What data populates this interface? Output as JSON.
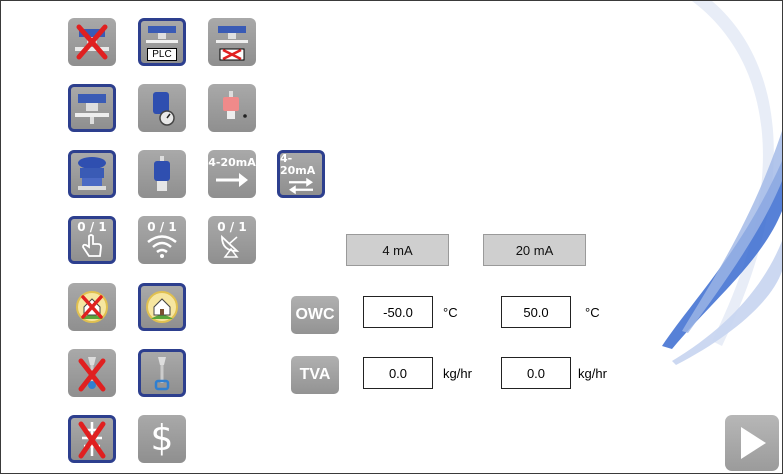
{
  "tiles": {
    "row4": [
      "0 / 1",
      "0 / 1",
      "0 / 1"
    ],
    "row3": {
      "current_out": "4-20mA",
      "current_bidir": "4-20mA"
    },
    "plc_label": "PLC",
    "currency": "$"
  },
  "calibration": {
    "btn_4ma": "4 mA",
    "btn_20ma": "20 mA"
  },
  "owc": {
    "label": "OWC",
    "low_value": "-50.0",
    "low_unit": "°C",
    "high_value": "50.0",
    "high_unit": "°C"
  },
  "tva": {
    "label": "TVA",
    "low_value": "0.0",
    "low_unit": "kg/hr",
    "high_value": "0.0",
    "high_unit": "kg/hr"
  },
  "icons": {
    "next": "play-arrow-icon"
  },
  "colors": {
    "selected_border": "#2d3f8e",
    "tile_gray": "#9c9c9c",
    "cross_red": "#e02020",
    "valve_blue": "#2f4fb0"
  }
}
